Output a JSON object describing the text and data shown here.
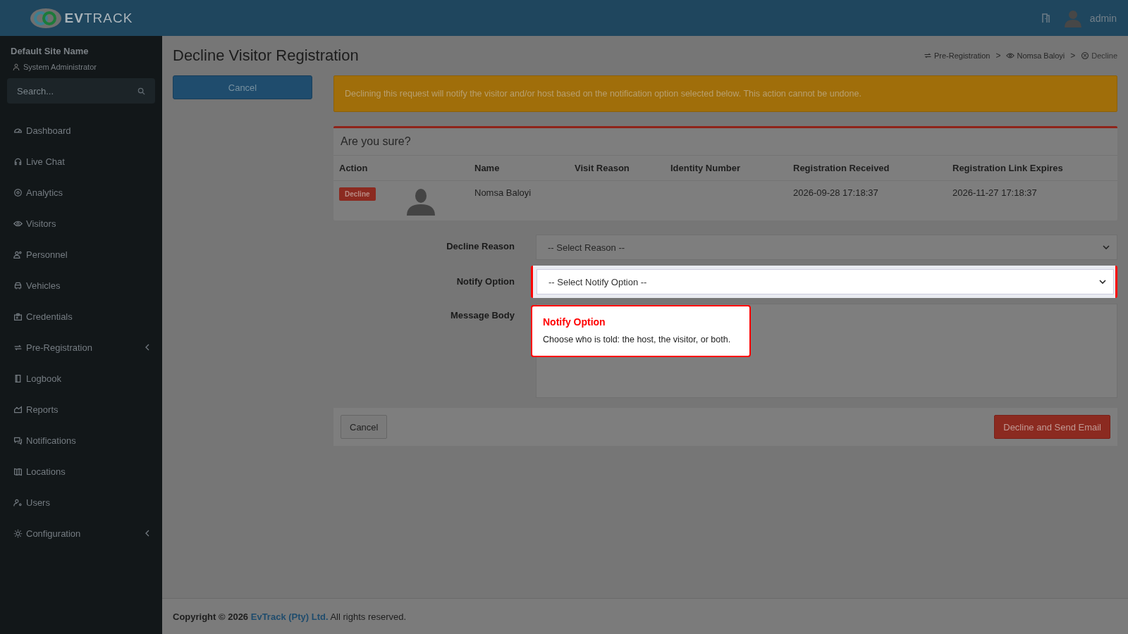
{
  "header": {
    "logo_bold": "EV",
    "logo_light": "TRACK",
    "user": "admin"
  },
  "sidebar": {
    "site_name": "Default Site Name",
    "role": "System Administrator",
    "search": {
      "placeholder": "Search..."
    },
    "items": [
      {
        "label": "Dashboard",
        "has_submenu": false
      },
      {
        "label": "Live Chat",
        "has_submenu": false
      },
      {
        "label": "Analytics",
        "has_submenu": false
      },
      {
        "label": "Visitors",
        "has_submenu": false
      },
      {
        "label": "Personnel",
        "has_submenu": false
      },
      {
        "label": "Vehicles",
        "has_submenu": false
      },
      {
        "label": "Credentials",
        "has_submenu": false
      },
      {
        "label": "Pre-Registration",
        "has_submenu": true
      },
      {
        "label": "Logbook",
        "has_submenu": false
      },
      {
        "label": "Reports",
        "has_submenu": false
      },
      {
        "label": "Notifications",
        "has_submenu": false
      },
      {
        "label": "Locations",
        "has_submenu": false
      },
      {
        "label": "Users",
        "has_submenu": false
      },
      {
        "label": "Configuration",
        "has_submenu": true
      }
    ]
  },
  "page": {
    "title": "Decline Visitor Registration",
    "breadcrumbs": [
      {
        "label": "Pre-Registration"
      },
      {
        "label": "Nomsa Baloyi"
      },
      {
        "label": "Decline"
      }
    ],
    "breadcrumb_separators": [
      ">",
      ">"
    ],
    "side_button": "Cancel",
    "alert": "Declining this request will notify the visitor and/or host based on the notification option selected below. This action cannot be undone.",
    "card": {
      "title": "Are you sure?",
      "table": {
        "columns": [
          "Action",
          "",
          "Name",
          "Visit Reason",
          "Identity Number",
          "Registration Received",
          "Registration Link Expires"
        ],
        "rows": [
          {
            "action": "Decline",
            "name": "Nomsa Baloyi",
            "received": "2026-09-28 17:18:37",
            "expires": "2026-11-27 17:18:37"
          }
        ]
      }
    },
    "form": [
      {
        "label": "Decline Reason",
        "kind": "select",
        "value": "-- Select Reason --",
        "highlighted": false
      },
      {
        "label": "Notify Option",
        "kind": "select",
        "value": "-- Select Notify Option --",
        "highlighted": true
      },
      {
        "label": "Message Body",
        "kind": "textarea",
        "highlighted": false
      }
    ],
    "tooltip": {
      "title": "Notify Option",
      "text": "Choose who is told: the host, the visitor, or both."
    },
    "actions": {
      "cancel": "Cancel",
      "submit": "Decline and Send Email"
    }
  },
  "footer": {
    "prefix": "Copyright © 2026",
    "company": "EvTrack (Pty) Ltd.",
    "suffix": "All rights reserved."
  }
}
